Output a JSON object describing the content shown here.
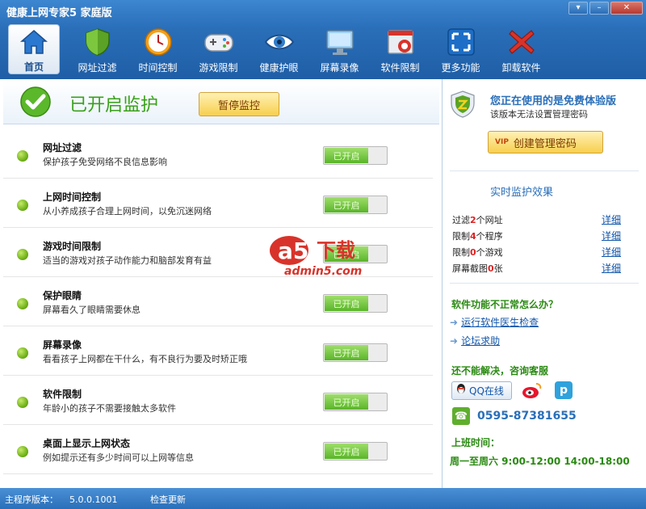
{
  "window": {
    "title": "健康上网专家5 家庭版",
    "btn_menu": "▾",
    "btn_min": "–",
    "btn_close": "✕"
  },
  "toolbar": [
    {
      "label": "首页",
      "icon": "home-icon"
    },
    {
      "label": "网址过滤",
      "icon": "shield-icon"
    },
    {
      "label": "时间控制",
      "icon": "clock-icon"
    },
    {
      "label": "游戏限制",
      "icon": "gamepad-icon"
    },
    {
      "label": "健康护眼",
      "icon": "eye-icon"
    },
    {
      "label": "屏幕录像",
      "icon": "monitor-icon"
    },
    {
      "label": "软件限制",
      "icon": "software-block-icon"
    },
    {
      "label": "更多功能",
      "icon": "expand-icon"
    },
    {
      "label": "卸载软件",
      "icon": "uninstall-x-icon"
    }
  ],
  "status": {
    "text": "已开启监护",
    "pause_label": "暂停监控"
  },
  "features": [
    {
      "title": "网址过滤",
      "desc": "保护孩子免受网络不良信息影响",
      "toggle": "已开启"
    },
    {
      "title": "上网时间控制",
      "desc": "从小养成孩子合理上网时间，以免沉迷网络",
      "toggle": "已开启"
    },
    {
      "title": "游戏时间限制",
      "desc": "适当的游戏对孩子动作能力和脑部发育有益",
      "toggle": "已开启"
    },
    {
      "title": "保护眼睛",
      "desc": "屏幕看久了眼睛需要休息",
      "toggle": "已开启"
    },
    {
      "title": "屏幕录像",
      "desc": "看看孩子上网都在干什么，有不良行为要及时矫正哦",
      "toggle": "已开启"
    },
    {
      "title": "软件限制",
      "desc": "年龄小的孩子不需要接触太多软件",
      "toggle": "已开启"
    },
    {
      "title": "桌面上显示上网状态",
      "desc": "例如提示还有多少时间可以上网等信息",
      "toggle": "已开启"
    }
  ],
  "watermark": {
    "logo": "a5",
    "brand": "下载",
    "site": "admin5.com"
  },
  "side": {
    "free_title": "您正在使用的是免费体验版",
    "free_desc": "该版本无法设置管理密码",
    "create_pwd": "创建管理密码",
    "vip": "VIP",
    "realtime_title": "实时监护效果",
    "stats": [
      {
        "pre": "过滤",
        "num": "2",
        "post": "个网址",
        "link": "详细"
      },
      {
        "pre": "限制",
        "num": "4",
        "post": "个程序",
        "link": "详细"
      },
      {
        "pre": "限制",
        "num": "0",
        "post": "个游戏",
        "link": "详细"
      },
      {
        "pre": "屏幕截图",
        "num": "0",
        "post": "张",
        "link": "详细"
      }
    ],
    "help_title": "软件功能不正常怎么办？",
    "help_links": [
      "运行软件医生检查",
      "论坛求助"
    ],
    "service_title": "还不能解决，咨询客服",
    "qq_label": "QQ在线",
    "tqq_label": "p",
    "phone": "0595-87381655",
    "hours_title": "上班时间：",
    "hours": "周一至周六 9:00-12:00 14:00-18:00"
  },
  "footer": {
    "version_label": "主程序版本：",
    "version": "5.0.0.1001",
    "update": "检查更新"
  },
  "colors": {
    "title_bar": "#2a6fb9",
    "on_green": "#59b528",
    "accent_yellow": "#f7cf4e",
    "link_blue": "#1155aa",
    "stat_red": "#dd2222"
  }
}
